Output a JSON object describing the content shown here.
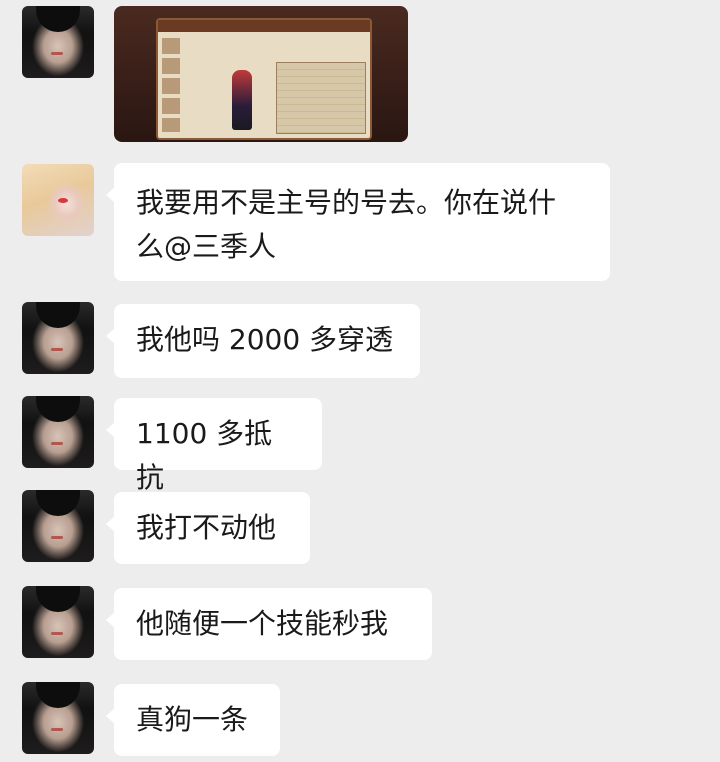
{
  "messages": [
    {
      "sender": "dark-hair",
      "type": "image",
      "image_desc": "game-character-screenshot"
    },
    {
      "sender": "blonde",
      "type": "text",
      "lines": [
        "我要用不是主号的号去。你在说什",
        "么@三季人"
      ]
    },
    {
      "sender": "dark-hair",
      "type": "text",
      "lines": [
        "我他吗 2000 多穿透"
      ]
    },
    {
      "sender": "dark-hair",
      "type": "text",
      "lines": [
        "1100 多抵抗"
      ]
    },
    {
      "sender": "dark-hair",
      "type": "text",
      "lines": [
        "我打不动他"
      ]
    },
    {
      "sender": "dark-hair",
      "type": "text",
      "lines": [
        "他随便一个技能秒我"
      ]
    },
    {
      "sender": "dark-hair",
      "type": "text",
      "lines": [
        "真狗一条"
      ]
    }
  ],
  "colors": {
    "background": "#ededed",
    "bubble": "#ffffff",
    "text": "#1a1a1a"
  },
  "icons": [
    "avatar-dark-hair",
    "avatar-blonde"
  ]
}
